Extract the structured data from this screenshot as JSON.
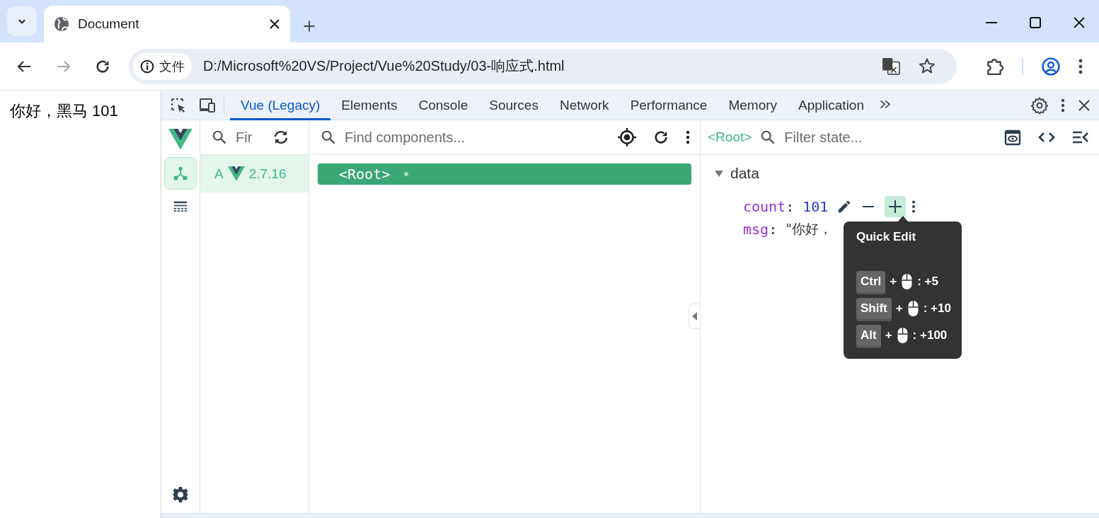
{
  "browser": {
    "tab_title": "Document",
    "address_chip": "文件",
    "url": "D:/Microsoft%20VS/Project/Vue%20Study/03-响应式.html"
  },
  "page": {
    "text": "你好，黑马 101"
  },
  "devtools": {
    "tabs": [
      {
        "label": "Vue (Legacy)",
        "selected": true
      },
      {
        "label": "Elements",
        "selected": false
      },
      {
        "label": "Console",
        "selected": false
      },
      {
        "label": "Sources",
        "selected": false
      },
      {
        "label": "Network",
        "selected": false
      },
      {
        "label": "Performance",
        "selected": false
      },
      {
        "label": "Memory",
        "selected": false
      },
      {
        "label": "Application",
        "selected": false
      }
    ]
  },
  "vue": {
    "rail_items": [
      {
        "kind": "components",
        "selected": true
      },
      {
        "kind": "timeline",
        "selected": false
      }
    ],
    "apps": {
      "search_placeholder": "Fir",
      "items": [
        {
          "name": "A",
          "version": "2.7.16",
          "selected": true
        }
      ]
    },
    "components": {
      "search_placeholder": "Find components...",
      "tree": [
        {
          "name": "<Root>",
          "selected": true
        }
      ]
    },
    "state": {
      "component": "<Root>",
      "filter_placeholder": "Filter state...",
      "sections": [
        {
          "title": "data",
          "expanded": true,
          "fields": [
            {
              "key": "count",
              "separator": ":",
              "value": "101",
              "kind": "number"
            },
            {
              "key": "msg",
              "separator": ":",
              "value": "\"你好，",
              "kind": "string"
            }
          ]
        }
      ]
    }
  },
  "tooltip": {
    "title": "Quick Edit",
    "shortcuts": [
      {
        "key": "Ctrl",
        "plus": "+",
        "amount": ": +5"
      },
      {
        "key": "Shift",
        "plus": "+",
        "amount": ": +10"
      },
      {
        "key": "Alt",
        "plus": "+",
        "amount": ": +100"
      }
    ]
  }
}
